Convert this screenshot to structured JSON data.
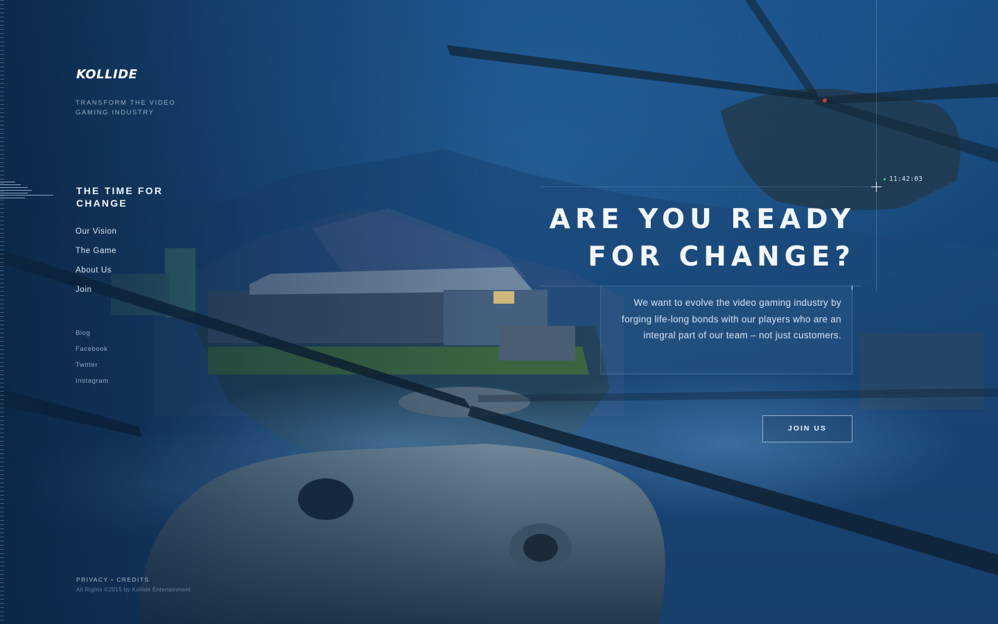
{
  "brand": {
    "logo_text": "KOLLIDE",
    "tagline": "TRANSFORM THE VIDEO GAMING INDUSTRY"
  },
  "sidebar": {
    "section_title": "THE TIME FOR CHANGE",
    "main_nav": [
      {
        "label": "Our Vision"
      },
      {
        "label": "The Game"
      },
      {
        "label": "About Us"
      },
      {
        "label": "Join"
      }
    ],
    "social_nav": [
      {
        "label": "Blog"
      },
      {
        "label": "Facebook"
      },
      {
        "label": "Twitter"
      },
      {
        "label": "Instagram"
      }
    ]
  },
  "footer": {
    "privacy": "PRIVACY",
    "credits": "CREDITS",
    "separator": "•",
    "copyright": "All Rights ©2015 by Kollide Entertainment"
  },
  "hero": {
    "clock": "11:42:03",
    "headline_line1": "ARE YOU READY",
    "headline_line2": "FOR CHANGE?",
    "description": "We want to evolve the video gaming industry by forging life-long bonds with our players who are an integral part of our team – not just customers.",
    "cta_label": "JOIN US"
  },
  "colors": {
    "background": "#0c2c52",
    "accent_text": "#f3f7fb",
    "clock_led": "#44e07a"
  }
}
